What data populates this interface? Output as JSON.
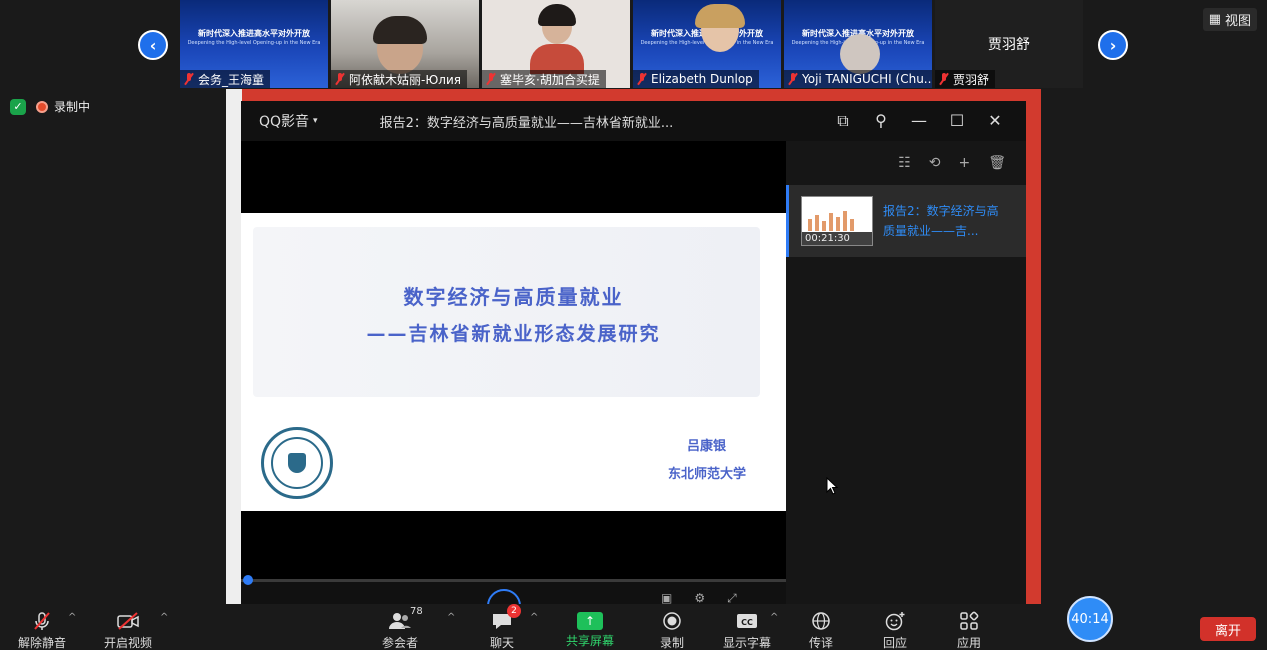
{
  "gallery": {
    "tiles": [
      {
        "name": "会务_王海童",
        "kind": "banner",
        "banner_title": "新时代深入推进高水平对外开放",
        "banner_sub": "Deepening the High-level Opening-up in the New Era"
      },
      {
        "name": "阿依献木姑丽-Юлия",
        "kind": "cam1"
      },
      {
        "name": "塞毕亥·胡加合买提",
        "kind": "cam2"
      },
      {
        "name": "Elizabeth Dunlop",
        "kind": "banner",
        "banner_title": "新时代深入推进高水平对外开放",
        "banner_sub": "Deepening the High-level Opening-up in the New Era"
      },
      {
        "name": "Yoji TANIGUCHI (Chu...",
        "kind": "banner",
        "banner_title": "新时代深入推进高水平对外开放",
        "banner_sub": "Deepening the High-level Opening-up in the New Era"
      },
      {
        "name": "贾羽舒",
        "kind": "dark",
        "big_name": "贾羽舒"
      }
    ],
    "view_label": "视图"
  },
  "status": {
    "recording_label": "录制中"
  },
  "player": {
    "brand": "QQ影音",
    "title": "报告2：数字经济与高质量就业——吉林省新就业...",
    "slide": {
      "title": "数字经济与高质量就业",
      "subtitle": "——吉林省新就业形态发展研究",
      "author": "吕康银",
      "university": "东北师范大学"
    },
    "playlist": {
      "item_title": "报告2：数字经济与高质量就业——吉...",
      "duration": "00:21:30"
    }
  },
  "toolbar": {
    "unmute": "解除静音",
    "start_video": "开启视频",
    "participants": "参会者",
    "participants_count": "78",
    "chat": "聊天",
    "chat_badge": "2",
    "share": "共享屏幕",
    "record": "录制",
    "captions": "显示字幕",
    "interpret": "传译",
    "reactions": "回应",
    "apps": "应用",
    "timer": "40:14",
    "leave": "离开"
  }
}
